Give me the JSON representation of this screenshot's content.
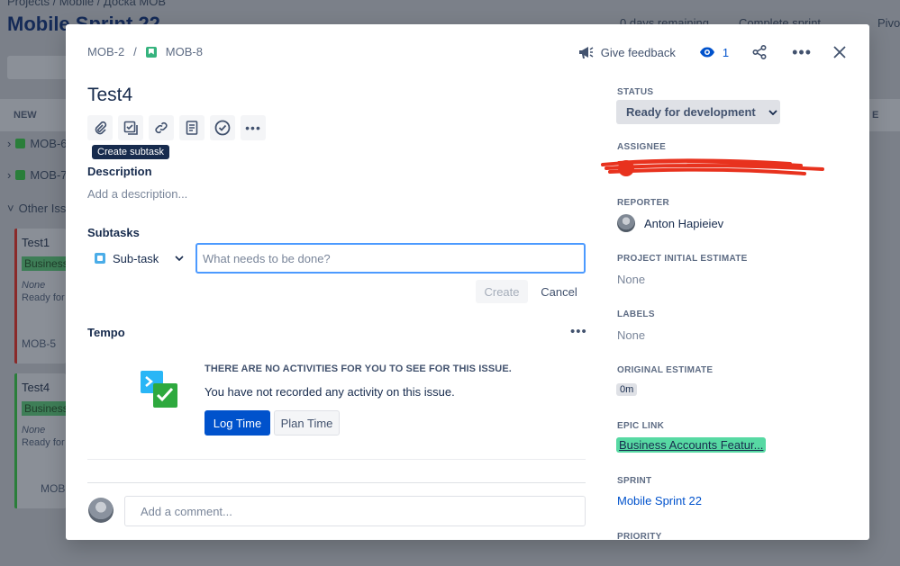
{
  "background": {
    "breadcrumb": "Projects  /  Mobile  /  Доска MOB",
    "board_title": "Mobile Sprint 22",
    "days_remaining": "0 days remaining",
    "complete_sprint": "Complete sprint",
    "pivot": "Pivo",
    "column_new": "NEW",
    "column_right": "E",
    "rows": [
      "MOB-6",
      "MOB-7"
    ],
    "other_issues": "Other Issu",
    "cards": [
      {
        "title": "Test1",
        "label": "Business",
        "estimate": "None",
        "status": "Ready for",
        "key": "MOB-5"
      },
      {
        "title": "Test4",
        "label": "Business",
        "estimate": "None",
        "status": "Ready for",
        "key": "MOB"
      }
    ]
  },
  "modal": {
    "breadcrumb": {
      "parent": "MOB-2",
      "current": "MOB-8"
    },
    "actions": {
      "feedback": "Give feedback",
      "watch_count": "1"
    },
    "title": "Test4",
    "tooltip": "Create subtask",
    "description": {
      "heading": "Description",
      "placeholder": "Add a description..."
    },
    "subtasks": {
      "heading": "Subtasks",
      "type": "Sub-task",
      "input_placeholder": "What needs to be done?",
      "create": "Create",
      "cancel": "Cancel"
    },
    "tempo": {
      "heading": "Tempo",
      "empty_title": "THERE ARE NO ACTIVITIES FOR YOU TO SEE FOR THIS ISSUE.",
      "empty_msg": "You have not recorded any activity on this issue.",
      "log_time": "Log Time",
      "plan_time": "Plan Time"
    },
    "comment_placeholder": "Add a comment..."
  },
  "sidebar": {
    "status_label": "STATUS",
    "status_value": "Ready for development",
    "assignee_label": "ASSIGNEE",
    "reporter_label": "REPORTER",
    "reporter_name": "Anton Hapieiev",
    "pie_label": "PROJECT INITIAL ESTIMATE",
    "pie_value": "None",
    "labels_label": "LABELS",
    "labels_value": "None",
    "orig_label": "ORIGINAL ESTIMATE",
    "orig_value": "0m",
    "epic_label": "EPIC LINK",
    "epic_value": "Business Accounts Featur...",
    "sprint_label": "SPRINT",
    "sprint_value": "Mobile Sprint 22",
    "priority_label": "PRIORITY"
  },
  "colors": {
    "primary": "#0052cc",
    "epic": "#57d9a3",
    "story": "#36b37e",
    "redaction": "#e8321e"
  }
}
